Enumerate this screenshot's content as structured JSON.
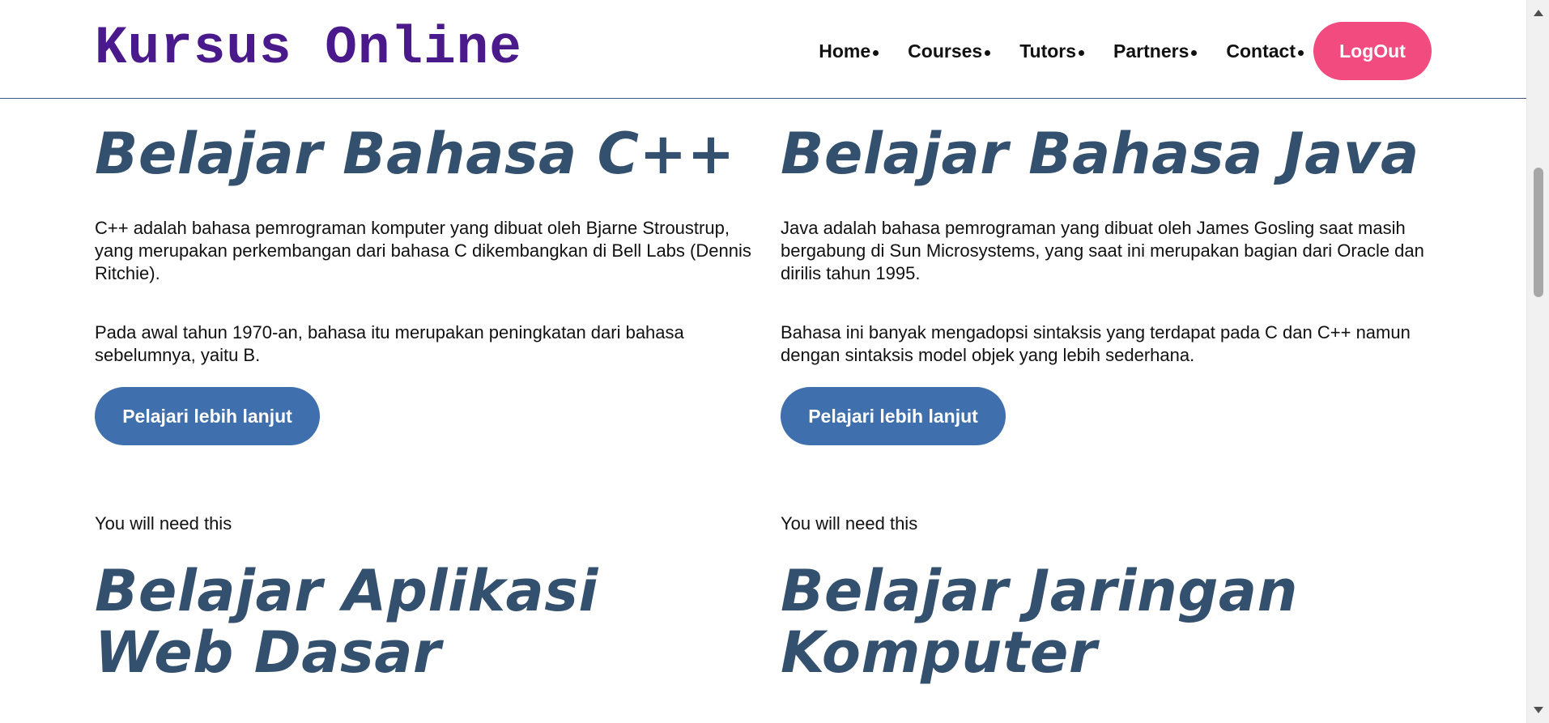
{
  "header": {
    "brand": "Kursus Online",
    "nav": [
      {
        "label": "Home"
      },
      {
        "label": "Courses"
      },
      {
        "label": "Tutors"
      },
      {
        "label": "Partners"
      },
      {
        "label": "Contact"
      }
    ],
    "logout_label": "LogOut"
  },
  "courses": [
    {
      "title": "Belajar Bahasa C++",
      "paragraphs": [
        "C++ adalah bahasa pemrograman komputer yang dibuat oleh Bjarne Stroustrup, yang merupakan perkembangan dari bahasa C dikembangkan di Bell Labs (Dennis Ritchie).",
        "Pada awal tahun 1970-an, bahasa itu merupakan peningkatan dari bahasa sebelumnya, yaitu B."
      ],
      "button_label": "Pelajari lebih lanjut",
      "footer_text": "You will need this"
    },
    {
      "title": "Belajar Bahasa Java",
      "paragraphs": [
        "Java adalah bahasa pemrograman yang dibuat oleh James Gosling saat masih bergabung di Sun Microsystems, yang saat ini merupakan bagian dari Oracle dan dirilis tahun 1995.",
        "Bahasa ini banyak mengadopsi sintaksis yang terdapat pada C dan C++ namun dengan sintaksis model objek yang lebih sederhana."
      ],
      "button_label": "Pelajari lebih lanjut",
      "footer_text": "You will need this"
    },
    {
      "title": "Belajar Aplikasi Web Dasar"
    },
    {
      "title": "Belajar Jaringan Komputer"
    }
  ],
  "colors": {
    "brand": "#4a1a8c",
    "title": "#34506f",
    "logout_bg": "#f24b7f",
    "button_bg": "#3f6fad",
    "header_border": "#3f5a7a"
  },
  "icons": {
    "nav_bullet": "dot-icon",
    "scroll_up": "scroll-up-arrow-icon",
    "scroll_down": "scroll-down-arrow-icon"
  }
}
